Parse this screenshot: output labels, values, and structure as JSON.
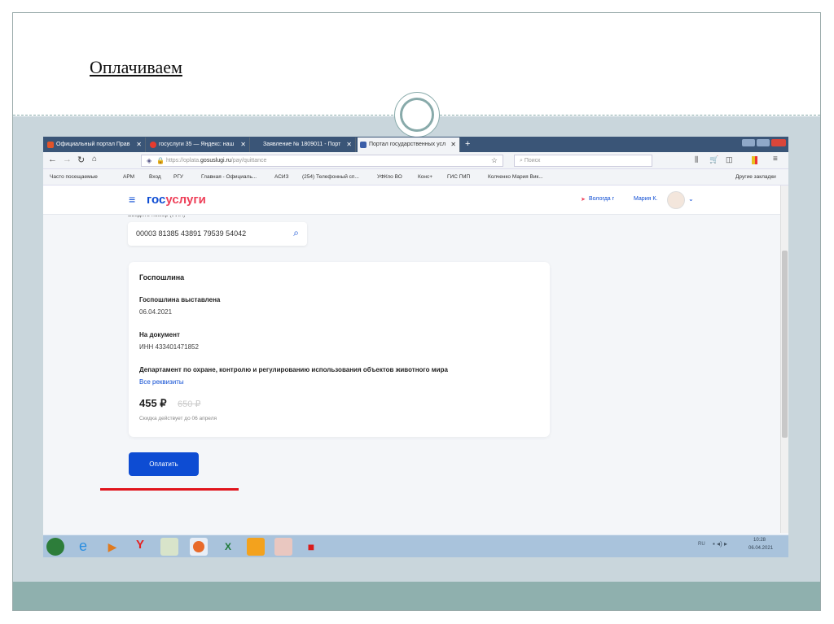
{
  "slide": {
    "title": "Оплачиваем"
  },
  "browser": {
    "tabs": [
      {
        "label": "Официальный портал Прав",
        "color": "#e2542a"
      },
      {
        "label": "госуслуги 35 — Яндекс: наш",
        "color": "#e63b2e"
      },
      {
        "label": "Заявление № 1809011 - Порт",
        "color": "#3a5577"
      },
      {
        "label": "Портал государственных усл",
        "color": "#3b5ea8"
      }
    ],
    "close": "✕",
    "new_tab": "+",
    "url_prefix": "https://oplata.",
    "url_domain": "gosuslugi.ru",
    "url_path": "/pay/quittance",
    "search_placeholder": "Поиск",
    "bookmarks": [
      "Часто посещаемые",
      "АРМ",
      "Вход",
      "РГУ",
      "Главная - Официаль...",
      "АСИЗ",
      "(254) Телефонный сп...",
      "УФКпо ВО",
      "Конс+",
      "ГИС ГМП",
      "Колченко Мария Вик..."
    ],
    "other_bookmarks": "Другие закладки"
  },
  "site": {
    "logo_a": "гос",
    "logo_b": "услуги",
    "location": "Вологда г",
    "user": "Мария К.",
    "input_label": "Введите номер (УИН)",
    "input_value": "00003 81385 43891 79539 54042",
    "card": {
      "title": "Госпошлина",
      "issued_label": "Госпошлина выставлена",
      "issued_date": "06.04.2021",
      "doc_label": "На документ",
      "doc_value": "ИНН 433401471852",
      "department": "Департамент по охране, контролю и регулированию использования объектов животного мира",
      "details_link": "Все реквизиты",
      "price": "455 ₽",
      "old_price": "650 ₽",
      "discount_note": "Скидка действует до 06 апреля"
    },
    "pay_button": "Оплатить"
  },
  "taskbar": {
    "lang": "RU",
    "time": "10:28",
    "date": "06.04.2021"
  }
}
